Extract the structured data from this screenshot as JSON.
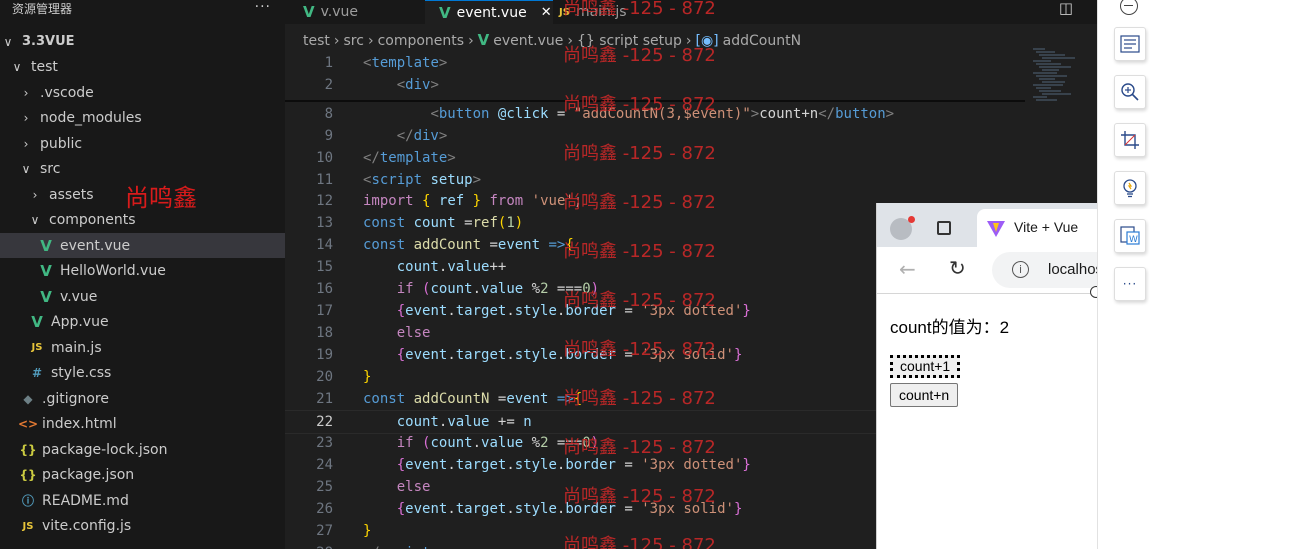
{
  "explorer": {
    "title": "资源管理器",
    "more": "···",
    "tree": [
      {
        "label": "3.3VUE",
        "type": "folder-open",
        "depth": 0,
        "bold": true
      },
      {
        "label": "test",
        "type": "folder-open",
        "depth": 1
      },
      {
        "label": ".vscode",
        "type": "folder",
        "depth": 2
      },
      {
        "label": "node_modules",
        "type": "folder",
        "depth": 2
      },
      {
        "label": "public",
        "type": "folder",
        "depth": 2
      },
      {
        "label": "src",
        "type": "folder-open",
        "depth": 2
      },
      {
        "label": "assets",
        "type": "folder",
        "depth": 3
      },
      {
        "label": "components",
        "type": "folder-open",
        "depth": 3
      },
      {
        "label": "event.vue",
        "type": "vue",
        "depth": 4,
        "active": true
      },
      {
        "label": "HelloWorld.vue",
        "type": "vue",
        "depth": 4
      },
      {
        "label": "v.vue",
        "type": "vue",
        "depth": 4
      },
      {
        "label": "App.vue",
        "type": "vue",
        "depth": 3
      },
      {
        "label": "main.js",
        "type": "js",
        "depth": 3
      },
      {
        "label": "style.css",
        "type": "css",
        "depth": 3
      },
      {
        "label": ".gitignore",
        "type": "git",
        "depth": 2
      },
      {
        "label": "index.html",
        "type": "html",
        "depth": 2
      },
      {
        "label": "package-lock.json",
        "type": "json",
        "depth": 2
      },
      {
        "label": "package.json",
        "type": "json",
        "depth": 2
      },
      {
        "label": "README.md",
        "type": "info",
        "depth": 2
      },
      {
        "label": "vite.config.js",
        "type": "js",
        "depth": 2
      }
    ],
    "watermark": "尚鸣鑫"
  },
  "editor": {
    "tabs": [
      {
        "label": "v.vue",
        "icon": "vue",
        "active": false
      },
      {
        "label": "event.vue",
        "icon": "vue",
        "active": true,
        "close": "✕"
      },
      {
        "label": "main.js",
        "icon": "js",
        "active": false
      }
    ],
    "breadcrumb": [
      "test",
      "src",
      "components",
      "event.vue",
      "{} script setup",
      "addCountN"
    ],
    "lines": [
      {
        "n": "1",
        "t": [
          [
            "t-ang",
            "<"
          ],
          [
            "t-tag",
            "template"
          ],
          [
            "t-ang",
            ">"
          ]
        ]
      },
      {
        "n": "2",
        "t": [
          [
            "t-txt",
            "    "
          ],
          [
            "t-ang",
            "<"
          ],
          [
            "t-tag",
            "div"
          ],
          [
            "t-ang",
            ">"
          ]
        ]
      },
      {
        "n": "8",
        "t": [
          [
            "t-txt",
            "        "
          ],
          [
            "t-ang",
            "<"
          ],
          [
            "t-tag",
            "button"
          ],
          [
            "t-txt",
            " "
          ],
          [
            "t-attr",
            "@click"
          ],
          [
            "t-txt",
            " = "
          ],
          [
            "t-str",
            "\"addCountN(3,$event)\""
          ],
          [
            "t-ang",
            ">"
          ],
          [
            "t-txt",
            "count+n"
          ],
          [
            "t-ang",
            "</"
          ],
          [
            "t-tag",
            "button"
          ],
          [
            "t-ang",
            ">"
          ]
        ]
      },
      {
        "n": "9",
        "t": [
          [
            "t-txt",
            "    "
          ],
          [
            "t-ang",
            "</"
          ],
          [
            "t-tag",
            "div"
          ],
          [
            "t-ang",
            ">"
          ]
        ]
      },
      {
        "n": "10",
        "t": [
          [
            "t-ang",
            "</"
          ],
          [
            "t-tag",
            "template"
          ],
          [
            "t-ang",
            ">"
          ]
        ]
      },
      {
        "n": "11",
        "t": [
          [
            "t-ang",
            "<"
          ],
          [
            "t-tag",
            "script"
          ],
          [
            "t-txt",
            " "
          ],
          [
            "t-attr",
            "setup"
          ],
          [
            "t-ang",
            ">"
          ]
        ]
      },
      {
        "n": "12",
        "t": [
          [
            "t-kw",
            "import"
          ],
          [
            "t-txt",
            " "
          ],
          [
            "t-br",
            "{"
          ],
          [
            "t-txt",
            " "
          ],
          [
            "t-var",
            "ref"
          ],
          [
            "t-txt",
            " "
          ],
          [
            "t-br",
            "}"
          ],
          [
            "t-txt",
            " "
          ],
          [
            "t-kw",
            "from"
          ],
          [
            "t-txt",
            " "
          ],
          [
            "t-str",
            "'vue'"
          ],
          [
            "t-txt",
            ";"
          ]
        ]
      },
      {
        "n": "13",
        "t": [
          [
            "t-decl",
            "const"
          ],
          [
            "t-txt",
            " "
          ],
          [
            "t-var",
            "count"
          ],
          [
            "t-txt",
            " ="
          ],
          [
            "t-fn",
            "ref"
          ],
          [
            "t-br",
            "("
          ],
          [
            "t-num",
            "1"
          ],
          [
            "t-br",
            ")"
          ]
        ]
      },
      {
        "n": "14",
        "t": [
          [
            "t-decl",
            "const"
          ],
          [
            "t-txt",
            " "
          ],
          [
            "t-fn",
            "addCount"
          ],
          [
            "t-txt",
            " ="
          ],
          [
            "t-var",
            "event"
          ],
          [
            "t-txt",
            " "
          ],
          [
            "t-decl",
            "=>"
          ],
          [
            "t-br",
            "{"
          ]
        ]
      },
      {
        "n": "15",
        "t": [
          [
            "t-txt",
            "    "
          ],
          [
            "t-var",
            "count"
          ],
          [
            "t-txt",
            "."
          ],
          [
            "t-var",
            "value"
          ],
          [
            "t-txt",
            "++"
          ]
        ]
      },
      {
        "n": "16",
        "t": [
          [
            "t-txt",
            "    "
          ],
          [
            "t-kw",
            "if"
          ],
          [
            "t-txt",
            " "
          ],
          [
            "t-br2",
            "("
          ],
          [
            "t-var",
            "count"
          ],
          [
            "t-txt",
            "."
          ],
          [
            "t-var",
            "value"
          ],
          [
            "t-txt",
            " %"
          ],
          [
            "t-num",
            "2"
          ],
          [
            "t-txt",
            " ==="
          ],
          [
            "t-num",
            "0"
          ],
          [
            "t-br2",
            ")"
          ]
        ]
      },
      {
        "n": "17",
        "t": [
          [
            "t-txt",
            "    "
          ],
          [
            "t-br2",
            "{"
          ],
          [
            "t-var",
            "event"
          ],
          [
            "t-txt",
            "."
          ],
          [
            "t-var",
            "target"
          ],
          [
            "t-txt",
            "."
          ],
          [
            "t-var",
            "style"
          ],
          [
            "t-txt",
            "."
          ],
          [
            "t-var",
            "border"
          ],
          [
            "t-txt",
            " = "
          ],
          [
            "t-str",
            "'3px dotted'"
          ],
          [
            "t-br2",
            "}"
          ]
        ]
      },
      {
        "n": "18",
        "t": [
          [
            "t-txt",
            "    "
          ],
          [
            "t-kw",
            "else"
          ]
        ]
      },
      {
        "n": "19",
        "t": [
          [
            "t-txt",
            "    "
          ],
          [
            "t-br2",
            "{"
          ],
          [
            "t-var",
            "event"
          ],
          [
            "t-txt",
            "."
          ],
          [
            "t-var",
            "target"
          ],
          [
            "t-txt",
            "."
          ],
          [
            "t-var",
            "style"
          ],
          [
            "t-txt",
            "."
          ],
          [
            "t-var",
            "border"
          ],
          [
            "t-txt",
            " = "
          ],
          [
            "t-str",
            "'3px solid'"
          ],
          [
            "t-br2",
            "}"
          ]
        ]
      },
      {
        "n": "20",
        "t": [
          [
            "t-br",
            "}"
          ]
        ]
      },
      {
        "n": "21",
        "t": [
          [
            "t-decl",
            "const"
          ],
          [
            "t-txt",
            " "
          ],
          [
            "t-fn",
            "addCountN"
          ],
          [
            "t-txt",
            " ="
          ],
          [
            "t-var",
            "event"
          ],
          [
            "t-txt",
            " "
          ],
          [
            "t-decl",
            "=>"
          ],
          [
            "t-br",
            "{"
          ]
        ]
      },
      {
        "n": "22",
        "current": true,
        "t": [
          [
            "t-txt",
            "    "
          ],
          [
            "t-var",
            "count"
          ],
          [
            "t-txt",
            "."
          ],
          [
            "t-var",
            "value"
          ],
          [
            "t-txt",
            " += "
          ],
          [
            "t-var",
            "n"
          ]
        ]
      },
      {
        "n": "23",
        "t": [
          [
            "t-txt",
            "    "
          ],
          [
            "t-kw",
            "if"
          ],
          [
            "t-txt",
            " "
          ],
          [
            "t-br2",
            "("
          ],
          [
            "t-var",
            "count"
          ],
          [
            "t-txt",
            "."
          ],
          [
            "t-var",
            "value"
          ],
          [
            "t-txt",
            " %"
          ],
          [
            "t-num",
            "2"
          ],
          [
            "t-txt",
            " ==="
          ],
          [
            "t-num",
            "0"
          ],
          [
            "t-br2",
            ")"
          ]
        ]
      },
      {
        "n": "24",
        "t": [
          [
            "t-txt",
            "    "
          ],
          [
            "t-br2",
            "{"
          ],
          [
            "t-var",
            "event"
          ],
          [
            "t-txt",
            "."
          ],
          [
            "t-var",
            "target"
          ],
          [
            "t-txt",
            "."
          ],
          [
            "t-var",
            "style"
          ],
          [
            "t-txt",
            "."
          ],
          [
            "t-var",
            "border"
          ],
          [
            "t-txt",
            " = "
          ],
          [
            "t-str",
            "'3px dotted'"
          ],
          [
            "t-br2",
            "}"
          ]
        ]
      },
      {
        "n": "25",
        "t": [
          [
            "t-txt",
            "    "
          ],
          [
            "t-kw",
            "else"
          ]
        ]
      },
      {
        "n": "26",
        "t": [
          [
            "t-txt",
            "    "
          ],
          [
            "t-br2",
            "{"
          ],
          [
            "t-var",
            "event"
          ],
          [
            "t-txt",
            "."
          ],
          [
            "t-var",
            "target"
          ],
          [
            "t-txt",
            "."
          ],
          [
            "t-var",
            "style"
          ],
          [
            "t-txt",
            "."
          ],
          [
            "t-var",
            "border"
          ],
          [
            "t-txt",
            " = "
          ],
          [
            "t-str",
            "'3px solid'"
          ],
          [
            "t-br2",
            "}"
          ]
        ]
      },
      {
        "n": "27",
        "t": [
          [
            "t-br",
            "}"
          ]
        ]
      },
      {
        "n": "28",
        "t": [
          [
            "t-ang",
            "</"
          ],
          [
            "t-tag",
            "script"
          ],
          [
            "t-ang",
            ">"
          ]
        ]
      }
    ],
    "watermark": "尚鸣鑫 -125 - 872"
  },
  "browser": {
    "tab_title": "Vite + Vue",
    "url": "localhost",
    "count_label": "count的值为：2",
    "button1": "count+1",
    "button2": "count+n"
  },
  "toolbar": {
    "buttons": [
      "minimize-icon",
      "ocr-text-icon",
      "zoom-in-icon",
      "crop-icon",
      "idea-icon",
      "word-export-icon",
      "more-icon"
    ]
  }
}
